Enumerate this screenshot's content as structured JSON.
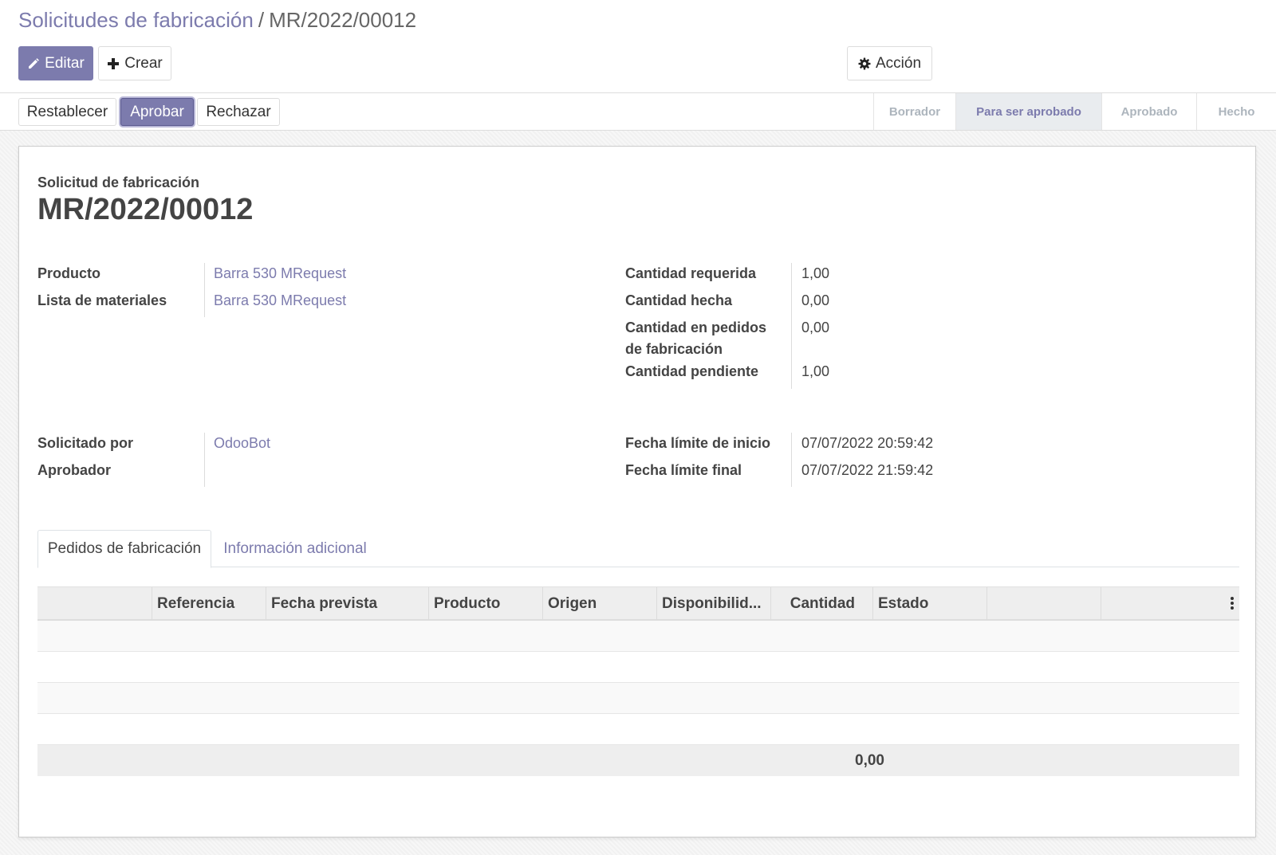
{
  "breadcrumb": {
    "parent": "Solicitudes de fabricación",
    "separator": "/",
    "current": "MR/2022/00012"
  },
  "toolbar": {
    "edit_label": "Editar",
    "create_label": "Crear",
    "action_label": "Acción"
  },
  "statusbar": {
    "buttons": {
      "reset": "Restablecer",
      "approve": "Aprobar",
      "reject": "Rechazar"
    },
    "stages": [
      "Borrador",
      "Para ser aprobado",
      "Aprobado",
      "Hecho"
    ],
    "active_stage": "Para ser aprobado"
  },
  "sheet": {
    "label": "Solicitud de fabricación",
    "title": "MR/2022/00012",
    "left_group1": {
      "product_label": "Producto",
      "product_value": "Barra 530 MRequest",
      "bom_label": "Lista de materiales",
      "bom_value": "Barra 530 MRequest"
    },
    "right_group1": {
      "qty_required_label": "Cantidad requerida",
      "qty_required_value": "1,00",
      "qty_done_label": "Cantidad hecha",
      "qty_done_value": "0,00",
      "qty_in_mo_label_line1": "Cantidad en pedidos",
      "qty_in_mo_label_line2": "de fabricación",
      "qty_in_mo_value": "0,00",
      "qty_pending_label": "Cantidad pendiente",
      "qty_pending_value": "1,00"
    },
    "left_group2": {
      "requested_by_label": "Solicitado por",
      "requested_by_value": "OdooBot",
      "approver_label": "Aprobador",
      "approver_value": ""
    },
    "right_group2": {
      "date_start_label": "Fecha límite de inicio",
      "date_start_value": "07/07/2022 20:59:42",
      "date_end_label": "Fecha límite final",
      "date_end_value": "07/07/2022 21:59:42"
    },
    "tabs": [
      "Pedidos de fabricación",
      "Información adicional"
    ],
    "table": {
      "columns": [
        "Referencia",
        "Fecha prevista",
        "Producto",
        "Origen",
        "Disponibilid...",
        "Cantidad",
        "Estado"
      ],
      "empty_rows": 4,
      "total": "0,00"
    }
  },
  "colors": {
    "accent": "#7c7bad",
    "text": "#444444",
    "muted": "#adb5bd"
  }
}
